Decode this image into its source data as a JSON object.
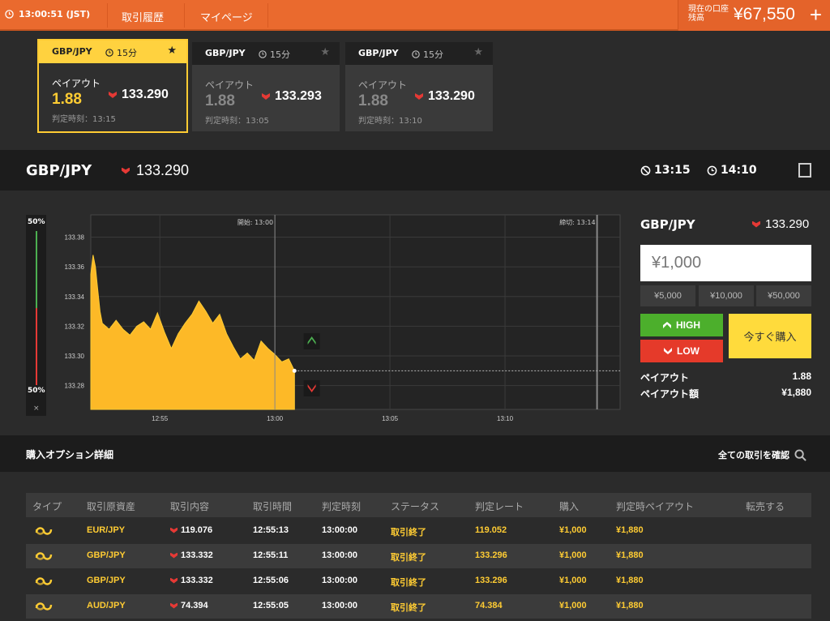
{
  "topbar": {
    "time": "13:00:51 (JST)",
    "nav": [
      "取引履歴",
      "マイページ"
    ],
    "balance_label": "現在の口座残高",
    "balance": "¥67,550",
    "plus": "+"
  },
  "cards": [
    {
      "pair": "GBP/JPY",
      "duration": "15分",
      "payout_label": "ペイアウト",
      "payout": "1.88",
      "rate": "133.290",
      "judge": "判定時刻：13:15",
      "active": true
    },
    {
      "pair": "GBP/JPY",
      "duration": "15分",
      "payout_label": "ペイアウト",
      "payout": "1.88",
      "rate": "133.293",
      "judge": "判定時刻：13:05",
      "active": false
    },
    {
      "pair": "GBP/JPY",
      "duration": "15分",
      "payout_label": "ペイアウト",
      "payout": "1.88",
      "rate": "133.290",
      "judge": "判定時刻：13:10",
      "active": false
    }
  ],
  "asset_header": {
    "pair": "GBP/JPY",
    "rate": "133.290",
    "deadline_time": "13:15",
    "next_time": "14:10"
  },
  "sentiment": {
    "high_pct": "50%",
    "low_pct": "50%",
    "close": "×"
  },
  "chart_data": {
    "type": "area",
    "y_ticks": [
      "133.38",
      "133.36",
      "133.34",
      "133.32",
      "133.30",
      "133.28"
    ],
    "x_ticks": [
      "12:55",
      "13:00",
      "13:05",
      "13:10"
    ],
    "ylim": [
      133.264,
      133.395
    ],
    "xlim": [
      "12:52",
      "13:15"
    ],
    "start_label": "開始: 13:00",
    "end_label": "締切: 13:14",
    "current_rate": 133.29,
    "points": [
      [
        "12:52:00",
        133.355
      ],
      [
        "12:52:06",
        133.368
      ],
      [
        "12:52:12",
        133.36
      ],
      [
        "12:52:18",
        133.345
      ],
      [
        "12:52:24",
        133.33
      ],
      [
        "12:52:30",
        133.322
      ],
      [
        "12:52:48",
        133.318
      ],
      [
        "12:53:06",
        133.324
      ],
      [
        "12:53:24",
        133.318
      ],
      [
        "12:53:42",
        133.314
      ],
      [
        "12:54:00",
        133.32
      ],
      [
        "12:54:18",
        133.323
      ],
      [
        "12:54:36",
        133.318
      ],
      [
        "12:54:54",
        133.329
      ],
      [
        "12:55:12",
        133.316
      ],
      [
        "12:55:30",
        133.305
      ],
      [
        "12:55:48",
        133.315
      ],
      [
        "12:56:06",
        133.322
      ],
      [
        "12:56:24",
        133.328
      ],
      [
        "12:56:42",
        133.337
      ],
      [
        "12:57:00",
        133.33
      ],
      [
        "12:57:18",
        133.322
      ],
      [
        "12:57:36",
        133.328
      ],
      [
        "12:57:54",
        133.315
      ],
      [
        "12:58:12",
        133.306
      ],
      [
        "12:58:30",
        133.298
      ],
      [
        "12:58:48",
        133.302
      ],
      [
        "12:59:06",
        133.297
      ],
      [
        "12:59:24",
        133.31
      ],
      [
        "12:59:42",
        133.305
      ],
      [
        "13:00:00",
        133.301
      ],
      [
        "13:00:18",
        133.296
      ],
      [
        "13:00:36",
        133.298
      ],
      [
        "13:00:51",
        133.29
      ]
    ]
  },
  "panel": {
    "pair": "GBP/JPY",
    "rate": "133.290",
    "amount": "¥1,000",
    "quick": [
      "¥5,000",
      "¥10,000",
      "¥50,000"
    ],
    "high": "HIGH",
    "low": "LOW",
    "buy": "今すぐ購入",
    "payout_label": "ペイアウト",
    "payout": "1.88",
    "payout_amt_label": "ペイアウト額",
    "payout_amt": "¥1,880"
  },
  "details": {
    "title": "購入オプション詳細",
    "link": "全ての取引を確認",
    "headers": [
      "タイプ",
      "取引原資産",
      "取引内容",
      "取引時間",
      "判定時刻",
      "ステータス",
      "判定レート",
      "購入",
      "判定時ペイアウト",
      "転売する"
    ],
    "rows": [
      {
        "asset": "EUR/JPY",
        "content": "119.076",
        "time": "12:55:13",
        "judge": "13:00:00",
        "status": "取引終了",
        "rate": "119.052",
        "buy": "¥1,000",
        "payout": "¥1,880"
      },
      {
        "asset": "GBP/JPY",
        "content": "133.332",
        "time": "12:55:11",
        "judge": "13:00:00",
        "status": "取引終了",
        "rate": "133.296",
        "buy": "¥1,000",
        "payout": "¥1,880"
      },
      {
        "asset": "GBP/JPY",
        "content": "133.332",
        "time": "12:55:06",
        "judge": "13:00:00",
        "status": "取引終了",
        "rate": "133.296",
        "buy": "¥1,000",
        "payout": "¥1,880"
      },
      {
        "asset": "AUD/JPY",
        "content": "74.394",
        "time": "12:55:05",
        "judge": "13:00:00",
        "status": "取引終了",
        "rate": "74.384",
        "buy": "¥1,000",
        "payout": "¥1,880"
      }
    ]
  },
  "colors": {
    "accent": "#ea6a2e",
    "yellow": "#ffcc33",
    "high": "#4caf2c",
    "low": "#e53a2a"
  }
}
